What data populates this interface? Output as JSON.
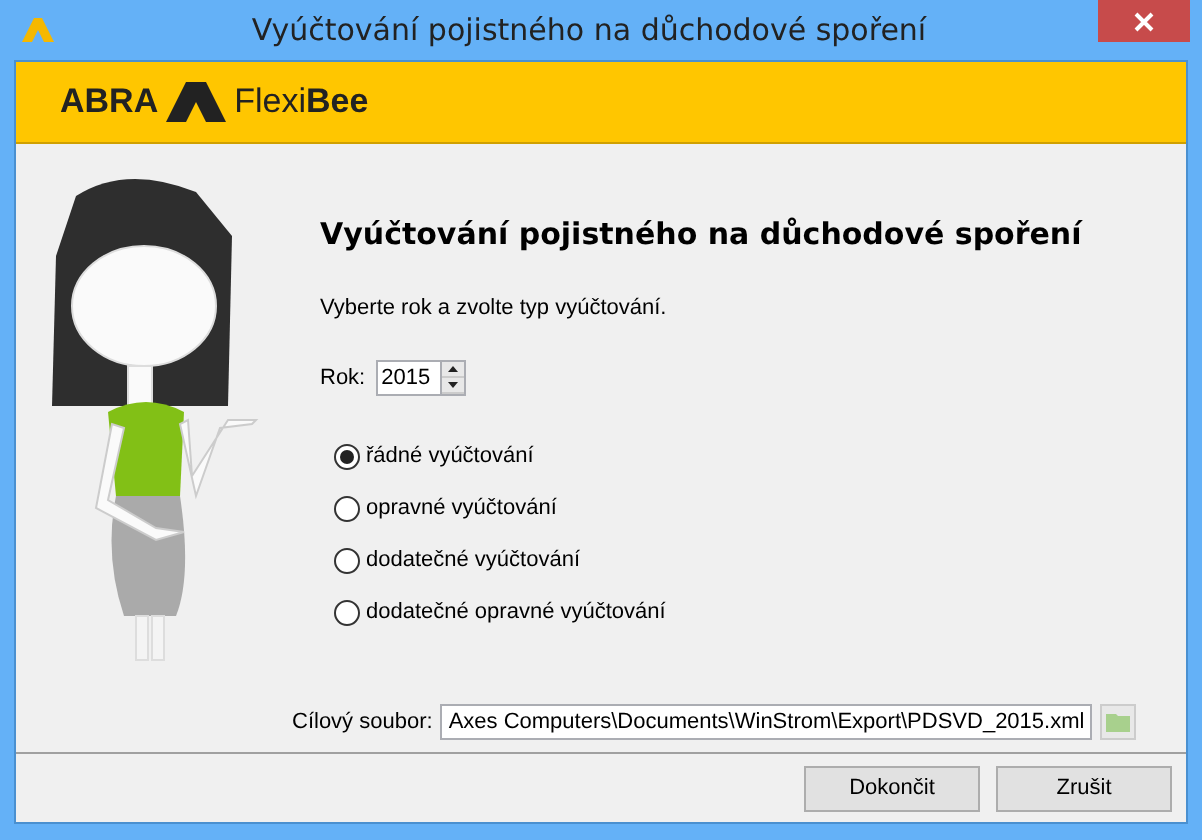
{
  "window": {
    "title": "Vyúčtování pojistného na důchodové spoření"
  },
  "banner": {
    "brand": "ABRA",
    "product": "Flexi**Bee**"
  },
  "heading": "Vyúčtování pojistného na důchodové spoření",
  "instruction": "Vyberte rok a zvolte typ vyúčtování.",
  "year": {
    "label": "Rok:",
    "value": "2015"
  },
  "options": [
    {
      "label": "řádné vyúčtování",
      "selected": true
    },
    {
      "label": "opravné vyúčtování",
      "selected": false
    },
    {
      "label": "dodatečné vyúčtování",
      "selected": false
    },
    {
      "label": "dodatečné opravné vyúčtování",
      "selected": false
    }
  ],
  "target_file": {
    "label": "Cílový soubor:",
    "value": "Axes Computers\\Documents\\WinStrom\\Export\\PDSVD_2015.xml"
  },
  "buttons": [
    "Dokončit",
    "Zrušit"
  ]
}
